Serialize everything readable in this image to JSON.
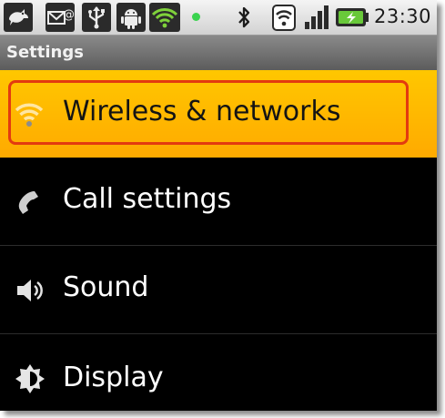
{
  "status_bar": {
    "icons": [
      "twitter-bird-icon",
      "email-icon",
      "usb-icon",
      "android-debug-icon",
      "wifi-notification-icon",
      "led-indicator-icon",
      "bluetooth-icon",
      "wifi-icon",
      "signal-strength-icon",
      "battery-charging-icon"
    ],
    "time": "23:30"
  },
  "header": {
    "title": "Settings"
  },
  "settings_list": [
    {
      "label": "Wireless & networks",
      "icon": "wifi-icon",
      "selected": true
    },
    {
      "label": "Call settings",
      "icon": "phone-icon",
      "selected": false
    },
    {
      "label": "Sound",
      "icon": "speaker-icon",
      "selected": false
    },
    {
      "label": "Display",
      "icon": "brightness-icon",
      "selected": false
    }
  ],
  "colors": {
    "selected_background": "#ffb800",
    "highlight_ring": "#e33a10",
    "list_background": "#000000",
    "title_bar": "#6f6f6f"
  }
}
